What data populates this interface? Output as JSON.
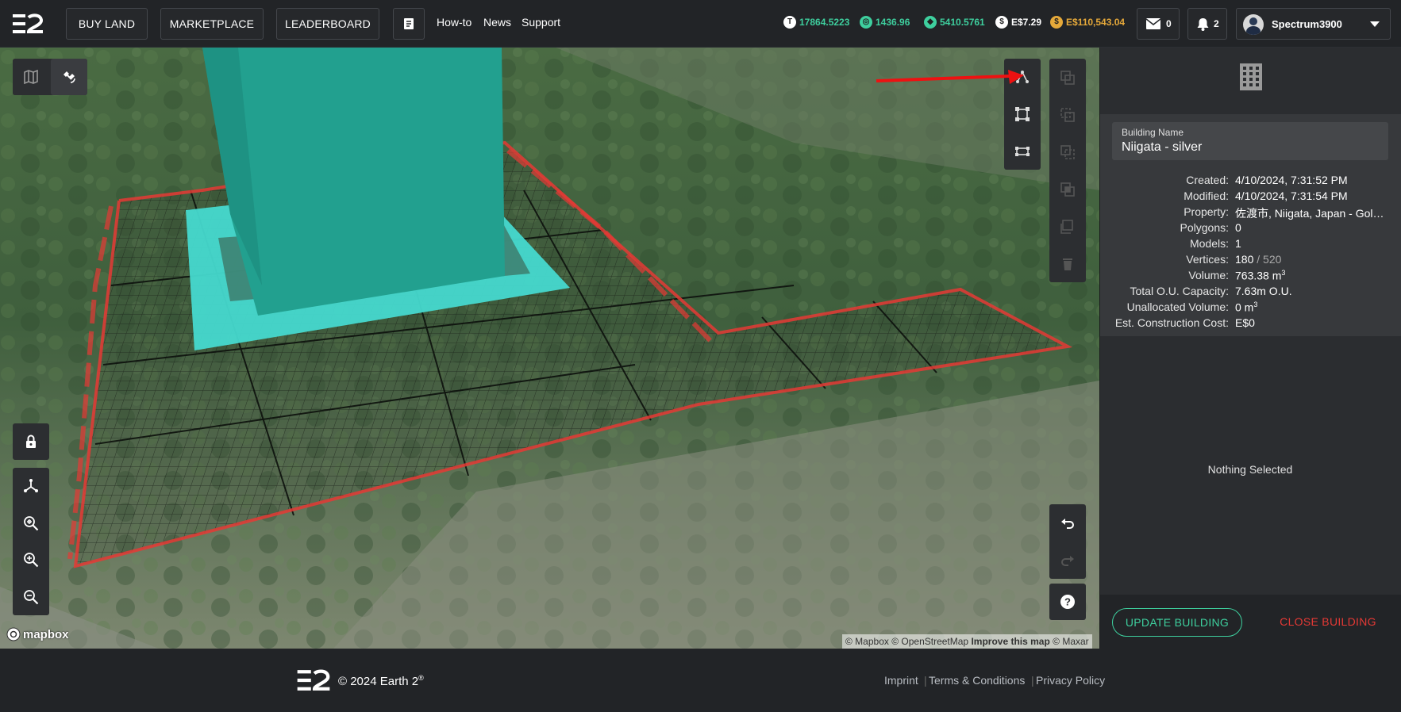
{
  "nav": {
    "buy_land": "BUY LAND",
    "marketplace": "MARKETPLACE",
    "leaderboard": "LEADERBOARD",
    "howto": "How-to",
    "news": "News",
    "support": "Support"
  },
  "balances": {
    "tile": "17864.5223",
    "ether": "1436.96",
    "essence": "5410.5761",
    "cash": "E$7.29",
    "gold": "E$110,543.04"
  },
  "colors": {
    "green": "#3ecf9e",
    "gold": "#e6a93a",
    "red": "#e53935"
  },
  "messages_count": "0",
  "notifications_count": "2",
  "username": "Spectrum3900",
  "panel": {
    "building_name_label": "Building Name",
    "building_name_value": "Niigata - silver",
    "rows": [
      {
        "k": "Created:",
        "v": "4/10/2024, 7:31:52 PM"
      },
      {
        "k": "Modified:",
        "v": "4/10/2024, 7:31:54 PM"
      },
      {
        "k": "Property:",
        "v": "佐渡市, Niigata, Japan - Gol…"
      },
      {
        "k": "Polygons:",
        "v": "0"
      },
      {
        "k": "Models:",
        "v": "1"
      }
    ],
    "vertices_label": "Vertices:",
    "vertices_used": "180",
    "vertices_max": "/ 520",
    "volume_label": "Volume:",
    "volume_value": "763.38 m",
    "capacity_label": "Total O.U. Capacity:",
    "capacity_value": "7.63m O.U.",
    "unalloc_label": "Unallocated Volume:",
    "unalloc_value": "0 m",
    "cost_label": "Est. Construction Cost:",
    "cost_value": "E$0",
    "superscript": "3",
    "nothing_selected": "Nothing Selected",
    "update_button": "UPDATE BUILDING",
    "close_button": "CLOSE BUILDING"
  },
  "map": {
    "attribution_mapbox": "© Mapbox",
    "attribution_osm": "© OpenStreetMap",
    "improve": "Improve this map",
    "attribution_maxar": "© Maxar",
    "mapbox_logo_text": "mapbox"
  },
  "footer": {
    "copyright": "© 2024 Earth 2",
    "registered": "®",
    "imprint": "Imprint",
    "terms": "Terms & Conditions",
    "privacy": "Privacy Policy",
    "sep": "|"
  }
}
